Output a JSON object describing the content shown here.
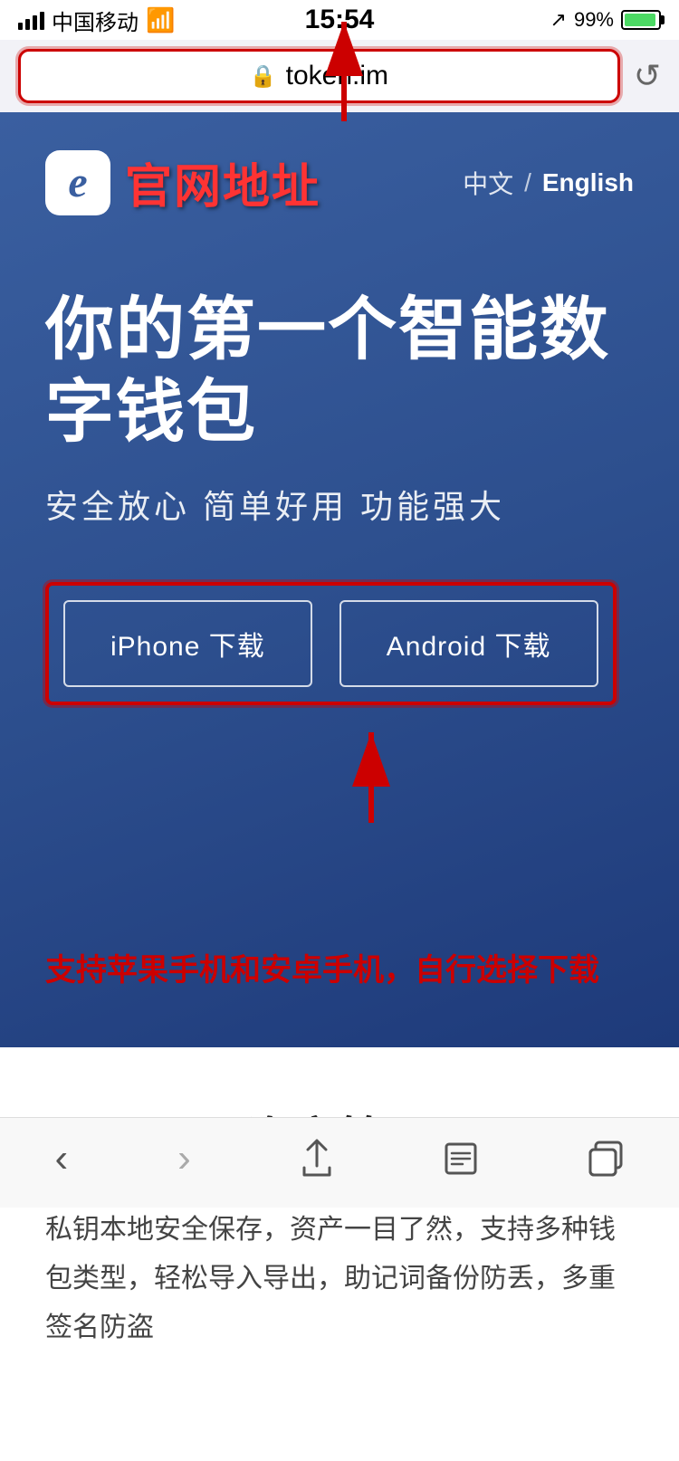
{
  "statusBar": {
    "carrier": "中国移动",
    "time": "15:54",
    "battery": "99%",
    "signal": "full"
  },
  "browserBar": {
    "url": "token.im",
    "lockIcon": "🔒",
    "refreshIcon": "↺"
  },
  "hero": {
    "logoIcon": "e",
    "siteTitle": "官网地址",
    "langZh": "中文",
    "langDivider": "/",
    "langEn": "English",
    "mainTitle": "你的第一个智能数字钱包",
    "subtitle": "安全放心  简单好用  功能强大",
    "iphoneBtn": "iPhone 下载",
    "androidBtn": "Android 下载",
    "annotationText": "支持苹果手机和安卓手机，自行选择下载"
  },
  "contentSection": {
    "title": "资产管理",
    "body": "私钥本地安全保存，资产一目了然，支持多种钱包类型，轻松导入导出，助记词备份防丢，多重签名防盗"
  },
  "bottomNav": {
    "back": "‹",
    "forward": "›",
    "share": "⬆",
    "bookmarks": "□",
    "tabs": "⧉"
  }
}
